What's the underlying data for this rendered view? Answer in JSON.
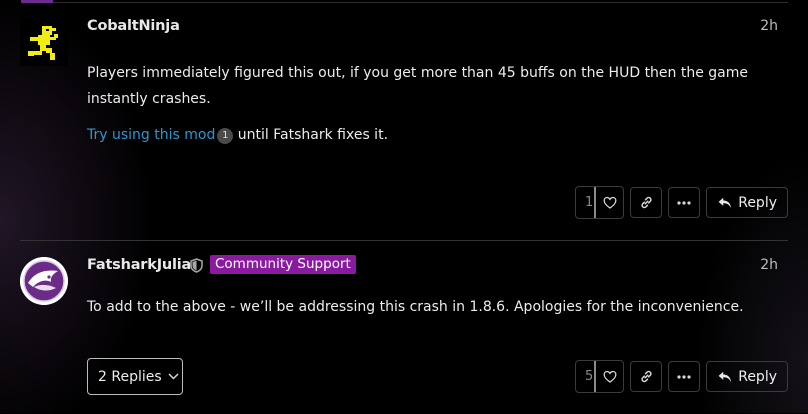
{
  "posts": [
    {
      "username": "CobaltNinja",
      "timestamp": "2h",
      "paragraph1": "Players immediately figured this out, if you get more than 45 buffs on the HUD then the game instantly crashes.",
      "link_text": "Try using this mod",
      "link_clicks": "1",
      "paragraph2_rest": " until Fatshark fixes it.",
      "like_count": "1",
      "reply_label": "Reply"
    },
    {
      "username": "FatsharkJulia",
      "badge": "Community Support",
      "timestamp": "2h",
      "paragraph1": "To add to the above - we’ll be addressing this crash in 1.8.6. Apologies for the inconvenience.",
      "replies_label": "2 Replies",
      "like_count": "5",
      "reply_label": "Reply"
    }
  ],
  "colors": {
    "link": "#2f96cf",
    "badge": "#8a1aa0",
    "accent": "#6c2b8e",
    "avatar_ninja": "#f2ec15"
  },
  "icons": [
    "heart-icon",
    "link-icon",
    "ellipsis-icon",
    "reply-arrow-icon",
    "chevron-down-icon",
    "shield-icon"
  ]
}
